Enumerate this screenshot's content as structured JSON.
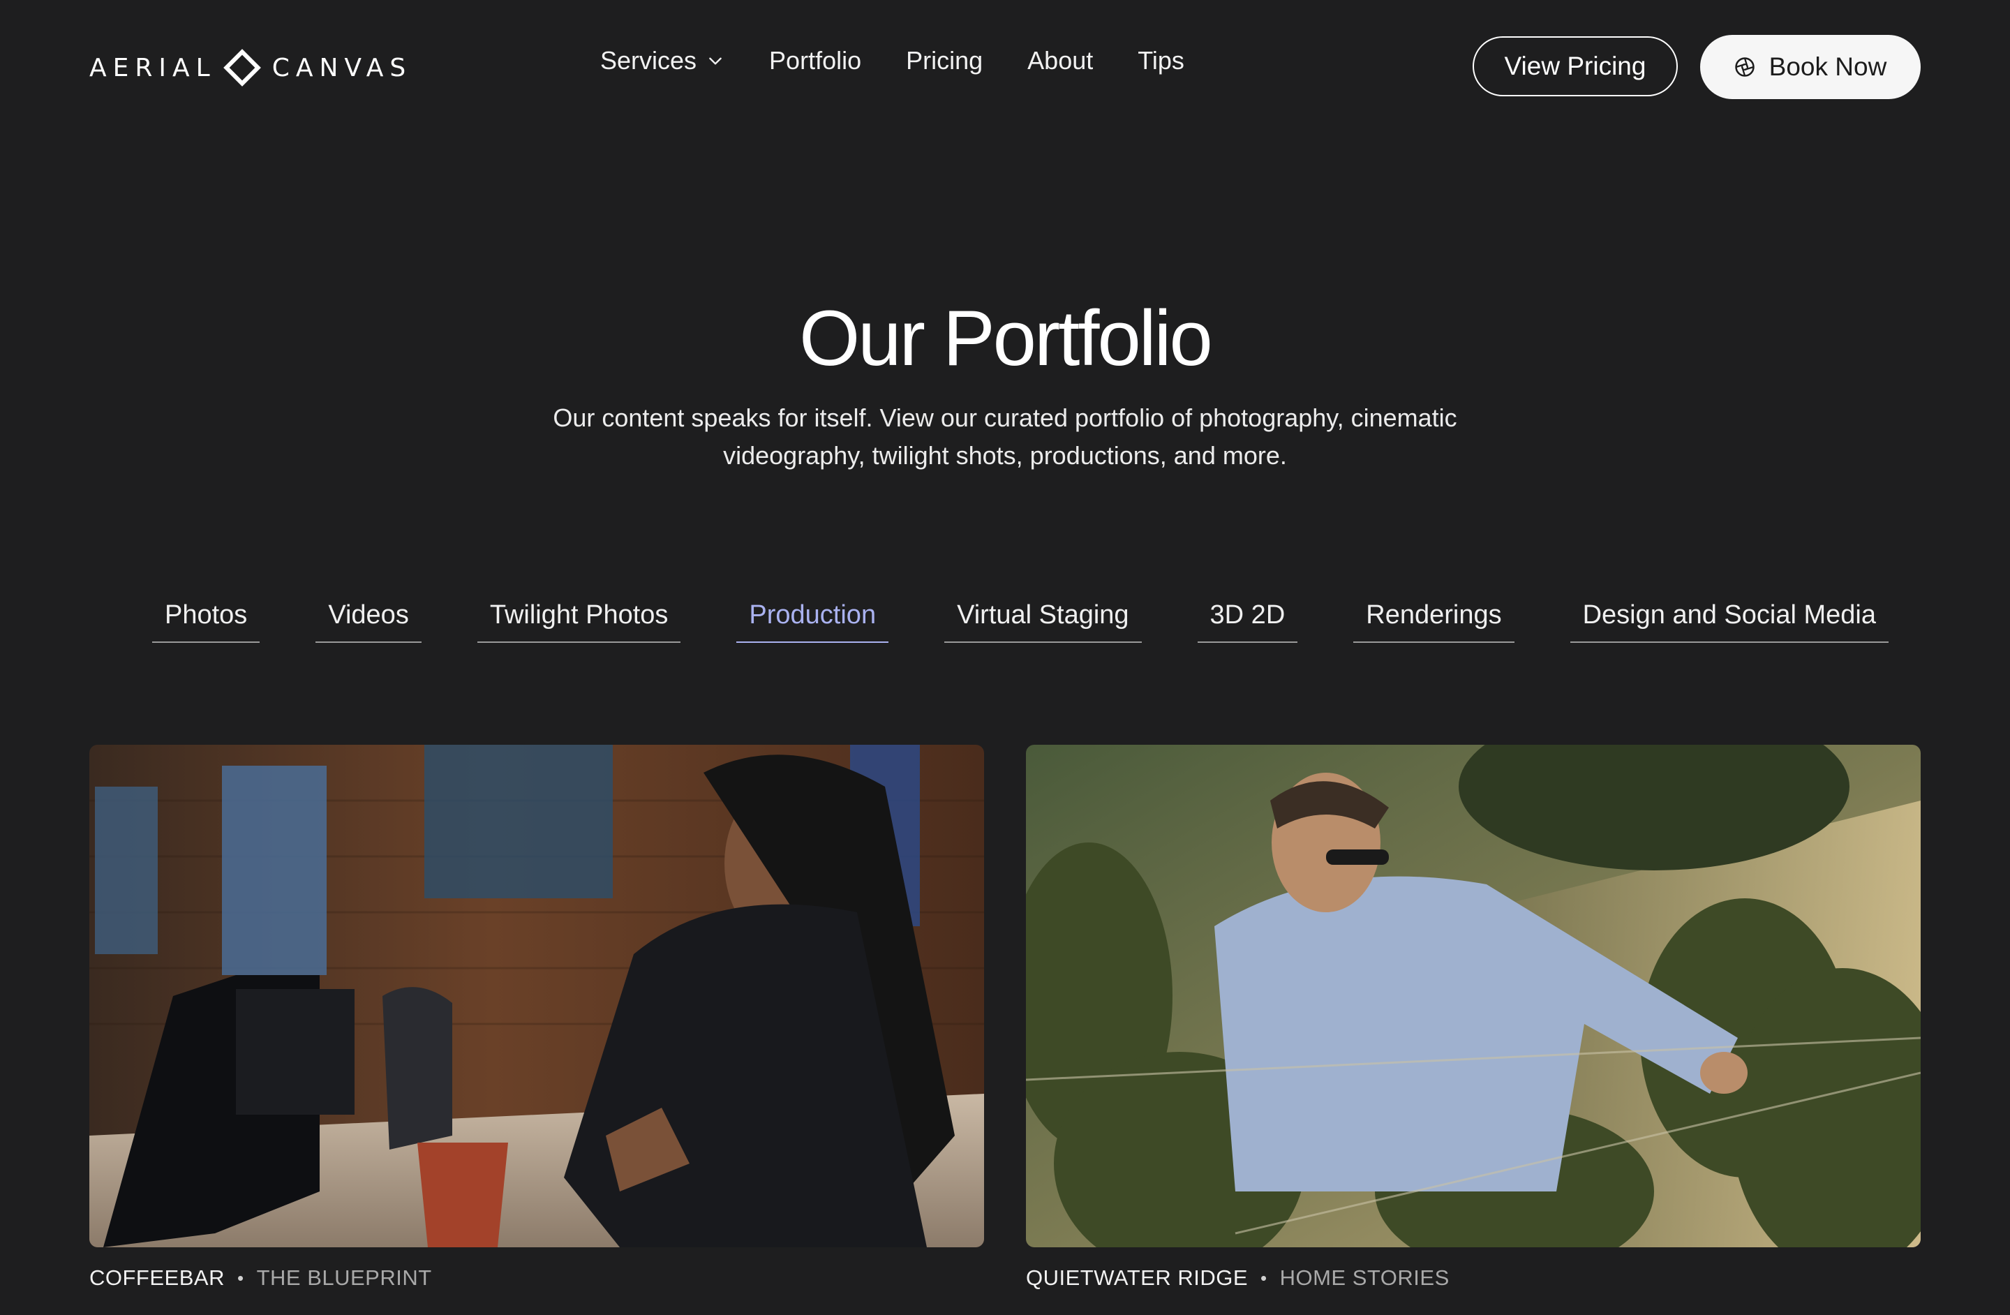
{
  "brand": {
    "word_left": "AERIAL",
    "word_right": "CANVAS"
  },
  "nav": {
    "items": [
      {
        "label": "Services",
        "has_dropdown": true
      },
      {
        "label": "Portfolio"
      },
      {
        "label": "Pricing"
      },
      {
        "label": "About"
      },
      {
        "label": "Tips"
      }
    ]
  },
  "header_actions": {
    "view_pricing": "View Pricing",
    "book_now": "Book Now"
  },
  "hero": {
    "title": "Our Portfolio",
    "subtitle": "Our content speaks for itself. View our curated portfolio of photography, cinematic videography, twilight shots, productions, and more."
  },
  "tabs": {
    "items": [
      {
        "label": "Photos",
        "active": false
      },
      {
        "label": "Videos",
        "active": false
      },
      {
        "label": "Twilight Photos",
        "active": false
      },
      {
        "label": "Production",
        "active": true
      },
      {
        "label": "Virtual Staging",
        "active": false
      },
      {
        "label": "3D 2D",
        "active": false
      },
      {
        "label": "Renderings",
        "active": false
      },
      {
        "label": "Design and Social Media",
        "active": false
      }
    ]
  },
  "portfolio": {
    "items": [
      {
        "title": "COFFEEBAR",
        "category": "THE BLUEPRINT"
      },
      {
        "title": "QUIETWATER RIDGE",
        "category": "HOME STORIES"
      }
    ]
  },
  "colors": {
    "background": "#1e1e1f",
    "accent_active_tab": "#aab2f0",
    "button_solid_bg": "#f6f6f6"
  }
}
